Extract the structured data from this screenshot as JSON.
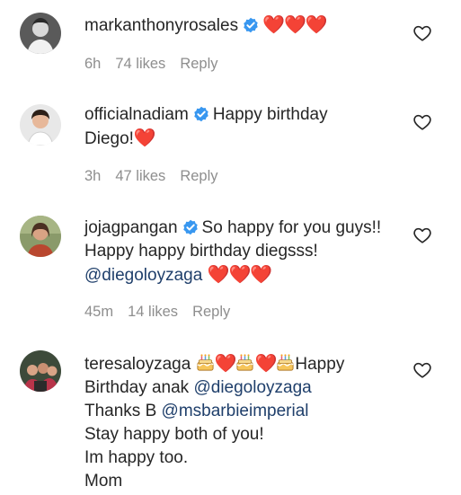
{
  "comments": [
    {
      "username": "markanthonyrosales",
      "verified": true,
      "body_emoji": "❤️❤️❤️",
      "time": "6h",
      "likes": "74 likes",
      "reply": "Reply"
    },
    {
      "username": "officialnadiam",
      "verified": true,
      "text_1": "Happy birthday",
      "text_2": "Diego!",
      "text_2_emoji": "❤️",
      "time": "3h",
      "likes": "47 likes",
      "reply": "Reply"
    },
    {
      "username": "jojagpangan",
      "verified": true,
      "text_1": "So happy for you guys!!",
      "text_2": "Happy happy birthday diegsss!",
      "mention": "@diegoloyzaga",
      "mention_emoji": "❤️❤️❤️",
      "time": "45m",
      "likes": "14 likes",
      "reply": "Reply"
    },
    {
      "username": "teresaloyzaga",
      "emoji_seq": "🎂❤️🎂❤️🎂",
      "text_1": "Happy",
      "text_2": "Birthday anak",
      "mention_1": "@diegoloyzaga",
      "text_3": "Thanks B",
      "mention_2": "@msbarbieimperial",
      "text_4": "Stay happy both of you!",
      "text_5": "Im happy too.",
      "text_6": "Mom"
    }
  ],
  "icons": {
    "verified": "verified-badge-icon",
    "like": "heart-outline-icon",
    "cake": "birthday-cake-icon"
  },
  "colors": {
    "verified": "#3897f0",
    "heart": "#ed1c2e",
    "mention": "#1f3f6b",
    "meta": "#8e8e8e"
  }
}
